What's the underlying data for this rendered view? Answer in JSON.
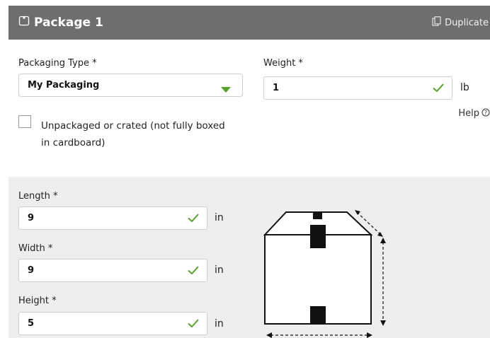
{
  "header": {
    "title": "Package 1",
    "duplicate_label": "Duplicate",
    "icons": [
      "package-icon",
      "copy-icon"
    ]
  },
  "packaging": {
    "label": "Packaging Type *",
    "value": "My Packaging"
  },
  "weight": {
    "label": "Weight *",
    "value": "1",
    "unit": "lb"
  },
  "unpackaged": {
    "label": "Unpackaged or crated (not fully boxed in cardboard)"
  },
  "help": {
    "label": "Help",
    "icon": "question-circle-icon"
  },
  "dimensions": {
    "length": {
      "label": "Length *",
      "value": "9",
      "unit": "in"
    },
    "width": {
      "label": "Width *",
      "value": "9",
      "unit": "in"
    },
    "height": {
      "label": "Height *",
      "value": "5",
      "unit": "in"
    }
  },
  "colors": {
    "header_bg": "#6e6e6e",
    "check_green": "#5aa02c",
    "section_bg": "#eeeeee"
  }
}
